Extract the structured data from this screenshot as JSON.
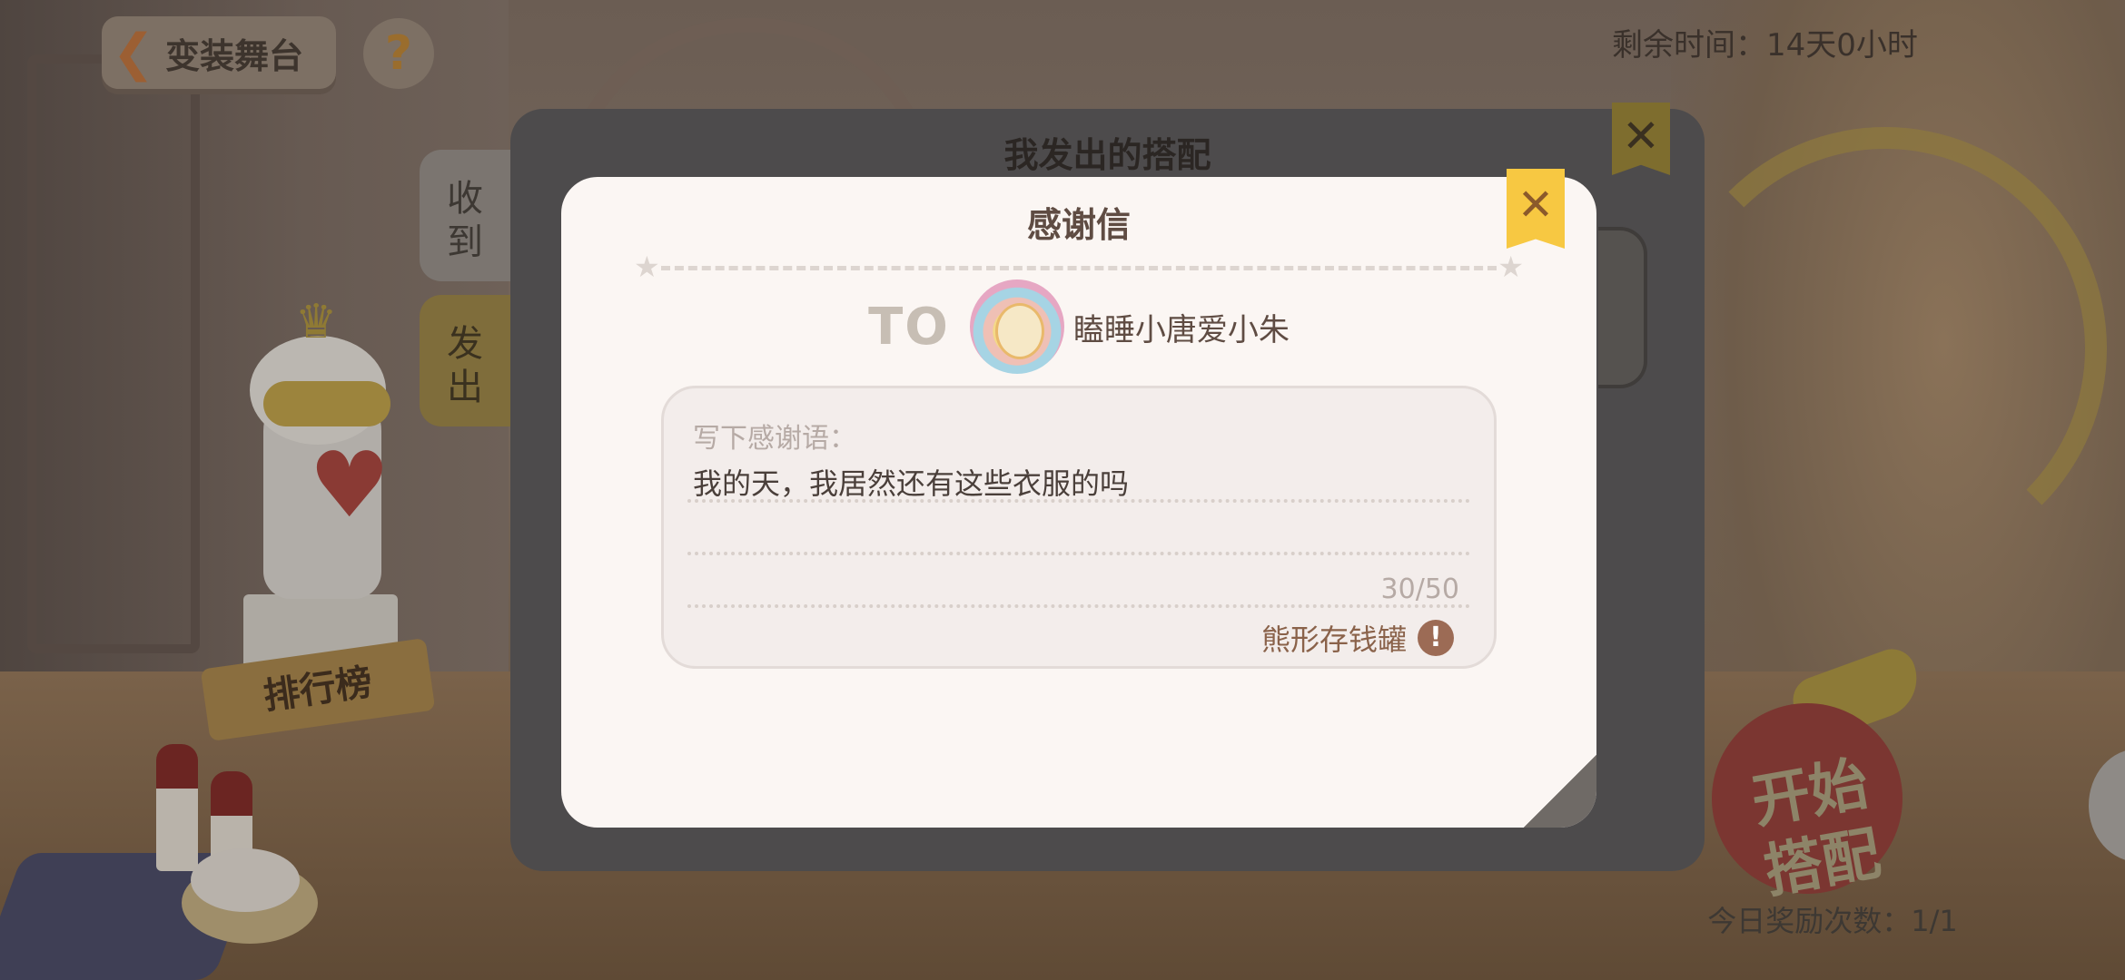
{
  "header": {
    "back_label": "变装舞台",
    "help_symbol": "?",
    "remaining_time": "剩余时间：14天0小时"
  },
  "background_panel": {
    "title": "我发出的搭配",
    "close_symbol": "✕",
    "tabs": [
      {
        "label": "收\n到"
      },
      {
        "label": "发\n出"
      }
    ]
  },
  "scene": {
    "rank_label": "排行榜",
    "start_button": "开始\n搭配",
    "reward_count": "今日奖励次数：1/1"
  },
  "letter": {
    "title": "感谢信",
    "close_symbol": "✕",
    "to_label": "TO",
    "recipient_name": "瞌睡小唐爱小朱",
    "input_hint": "写下感谢语：",
    "message": "我的天，我居然还有这些衣服的吗",
    "char_count": "30/50",
    "gift_name": "熊形存钱罐",
    "warn_symbol": "!"
  },
  "icons": {
    "back": "back-arrow-icon",
    "help": "question-icon",
    "close": "close-icon",
    "warning": "warning-icon",
    "star": "star-icon"
  },
  "colors": {
    "letter_bg": "#fbf6f3",
    "close_ribbon": "#f7c842",
    "title_text": "#5f4c43",
    "overlay_dim": "#4d4b4c"
  }
}
